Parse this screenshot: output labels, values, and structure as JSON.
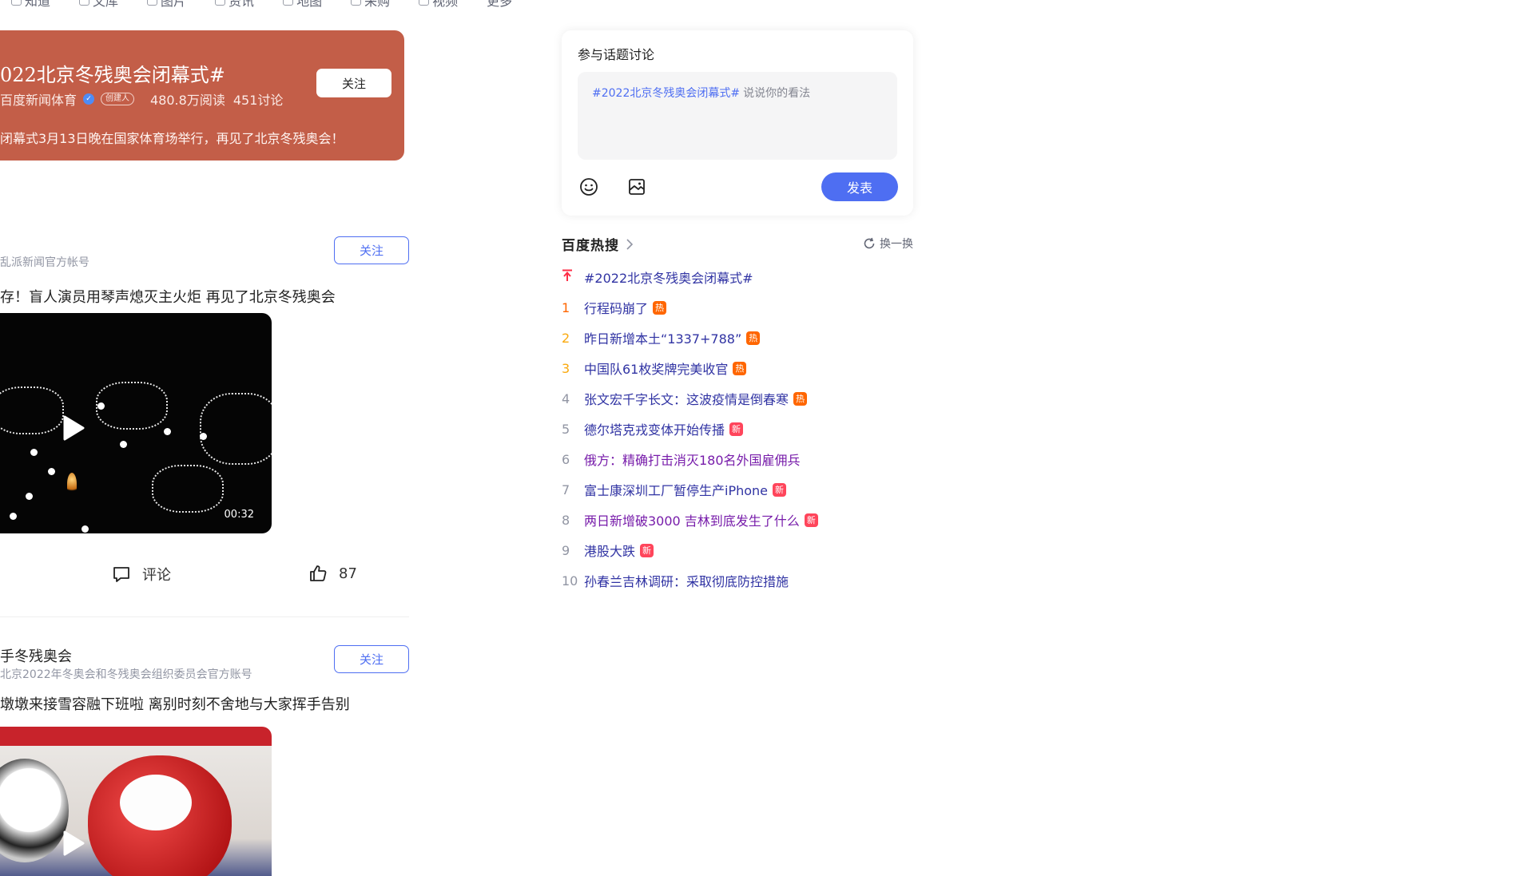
{
  "top_nav": {
    "items": [
      {
        "label": "知道",
        "icon": "question-icon"
      },
      {
        "label": "文库",
        "icon": "document-icon"
      },
      {
        "label": "图片",
        "icon": "image-icon"
      },
      {
        "label": "资讯",
        "icon": "news-icon"
      },
      {
        "label": "地图",
        "icon": "map-icon"
      },
      {
        "label": "采购",
        "icon": "cart-icon"
      },
      {
        "label": "视频",
        "icon": "video-icon"
      },
      {
        "label": "更多",
        "icon": ""
      }
    ]
  },
  "topic": {
    "title": "022北京冬残奥会闭幕式#",
    "author": "百度新闻体育",
    "creator_badge": "创建人",
    "reads": "480.8万阅读",
    "discussions": "451讨论",
    "description": "闭幕式3月13日晚在国家体育场举行，再见了北京冬残奥会！",
    "follow_label": "关注",
    "color": "#c35e48"
  },
  "posts": [
    {
      "account_name": "",
      "account_sub": "乱派新闻官方帐号",
      "follow_label": "关注",
      "title": "存！盲人演员用琴声熄灭主火炬 再见了北京冬残奥会",
      "duration": "00:32",
      "comment_label": "评论",
      "like_count": "87"
    },
    {
      "account_name": "手冬残奥会",
      "account_sub": "北京2022年冬奥会和冬残奥会组织委员会官方账号",
      "follow_label": "关注",
      "title": "墩墩来接雪容融下班啦 离别时刻不舍地与大家挥手告别"
    }
  ],
  "discussion": {
    "label": "参与话题讨论",
    "tag": "#2022北京冬残奥会闭幕式#",
    "placeholder": "说说你的看法",
    "publish_label": "发表",
    "accent": "#4e6ef2"
  },
  "hot_search": {
    "title": "百度热搜",
    "refresh_label": "换一换",
    "items": [
      {
        "rank": "",
        "pinned": true,
        "text": "#2022北京冬残奥会闭幕式#",
        "badge": "",
        "visited": false
      },
      {
        "rank": "1",
        "text": "行程码崩了",
        "badge": "热",
        "visited": false
      },
      {
        "rank": "2",
        "text": "昨日新增本土“1337+788”",
        "badge": "热",
        "visited": false
      },
      {
        "rank": "3",
        "text": "中国队61枚奖牌完美收官",
        "badge": "热",
        "visited": false
      },
      {
        "rank": "4",
        "text": "张文宏千字长文：这波疫情是倒春寒",
        "badge": "热",
        "visited": false
      },
      {
        "rank": "5",
        "text": "德尔塔克戎变体开始传播",
        "badge": "新",
        "visited": false
      },
      {
        "rank": "6",
        "text": "俄方：精确打击消灭180名外国雇佣兵",
        "badge": "",
        "visited": true
      },
      {
        "rank": "7",
        "text": "富士康深圳工厂暂停生产iPhone",
        "badge": "新",
        "visited": false
      },
      {
        "rank": "8",
        "text": "两日新增破3000 吉林到底发生了什么",
        "badge": "新",
        "visited": true
      },
      {
        "rank": "9",
        "text": "港股大跌",
        "badge": "新",
        "visited": false
      },
      {
        "rank": "10",
        "text": "孙春兰吉林调研：采取彻底防控措施",
        "badge": "",
        "visited": false
      }
    ],
    "colors": {
      "rank_1": "#fe2d46",
      "rank_2": "#f60",
      "rank_3": "#faa90e",
      "badge_hot": "#ff6600",
      "badge_new": "#ff455b",
      "pinned": "#fe2d46"
    }
  }
}
